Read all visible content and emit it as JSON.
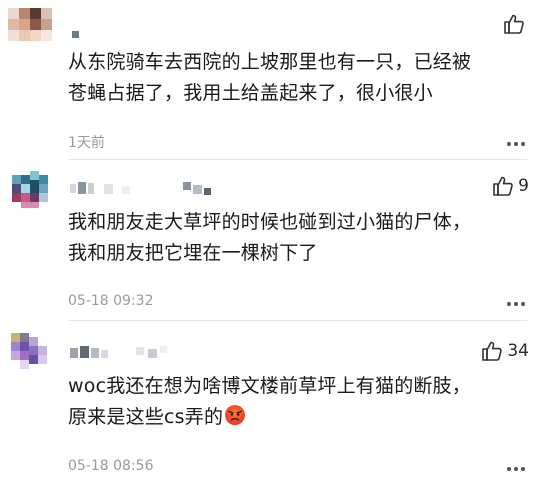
{
  "comments": [
    {
      "text_lines": [
        "从东院骑车去西院的上坡那里也有一只，已经被",
        "苍蝇占据了，我用土给盖起来了，很小很小"
      ],
      "time": "1天前",
      "like_count": ""
    },
    {
      "text_lines": [
        "我和朋友走大草坪的时候也碰到过小猫的尸体，",
        "我和朋友把它埋在一棵树下了"
      ],
      "time": "05-18 09:32",
      "like_count": "9"
    },
    {
      "text_lines": [
        "woc我还在想为啥博文楼前草坪上有猫的断肢，",
        "原来是这些cs弄的"
      ],
      "time": "05-18 08:56",
      "like_count": "34",
      "emoji": "angry-face-emoji"
    }
  ],
  "icons": {
    "like": "thumbs-up-icon",
    "more": "more-dots-icon"
  },
  "colors": {
    "text": "#1a1a1a",
    "time": "#9a9a9a",
    "divider": "#e6e6e6"
  }
}
